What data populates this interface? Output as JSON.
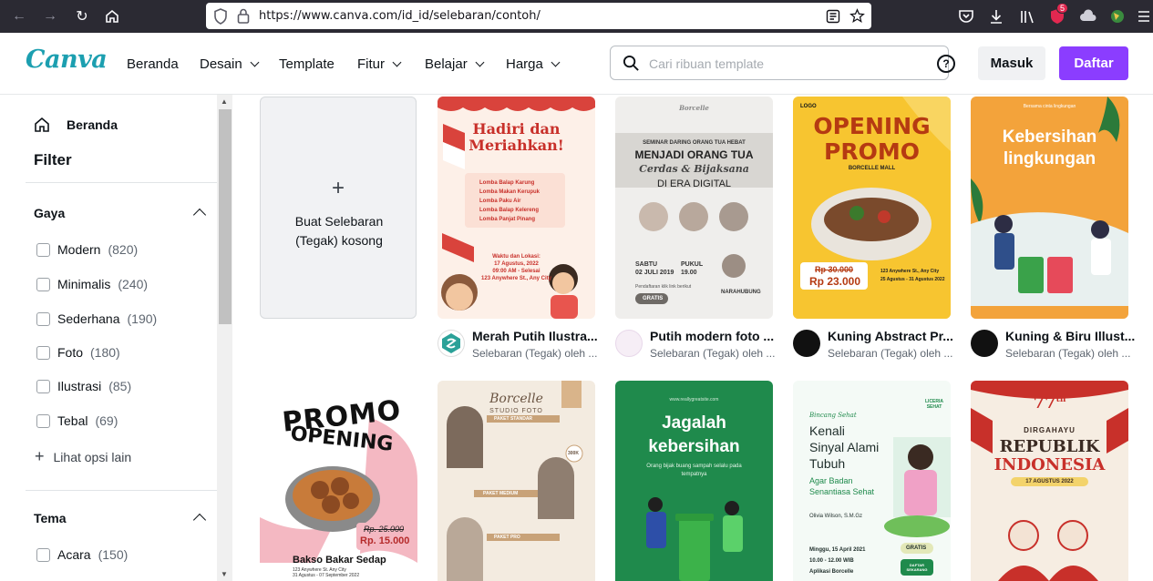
{
  "browser": {
    "url": "https://www.canva.com/id_id/selebaran/contoh/",
    "badge_count": "5"
  },
  "header": {
    "logo": "Canva",
    "nav": [
      {
        "label": "Beranda"
      },
      {
        "label": "Desain"
      },
      {
        "label": "Template"
      },
      {
        "label": "Fitur"
      },
      {
        "label": "Belajar"
      },
      {
        "label": "Harga"
      }
    ],
    "search_placeholder": "Cari ribuan template",
    "help": "?",
    "login_label": "Masuk",
    "signup_label": "Daftar",
    "accent_color": "#8b3dff"
  },
  "sidebar": {
    "home_label": "Beranda",
    "filter_title": "Filter",
    "gaya": {
      "title": "Gaya",
      "options": [
        {
          "label": "Modern",
          "count": "(820)"
        },
        {
          "label": "Minimalis",
          "count": "(240)"
        },
        {
          "label": "Sederhana",
          "count": "(190)"
        },
        {
          "label": "Foto",
          "count": "(180)"
        },
        {
          "label": "Ilustrasi",
          "count": "(85)"
        },
        {
          "label": "Tebal",
          "count": "(69)"
        }
      ],
      "more": "Lihat opsi lain"
    },
    "tema": {
      "title": "Tema",
      "options": [
        {
          "label": "Acara",
          "count": "(150)"
        }
      ]
    }
  },
  "grid": {
    "blank": {
      "plus": "+",
      "label_line1": "Buat Selebaran",
      "label_line2": "(Tegak) kosong"
    },
    "cards": [
      {
        "title": "Merah Putih Ilustra...",
        "subtitle": "Selebaran (Tegak) oleh ...",
        "preview": {
          "h1": "Hadiri dan",
          "h2": "Meriahkan!",
          "items": [
            "Lomba Balap Karung",
            "Lomba Makan Kerupuk",
            "Lomba Paku Air",
            "Lomba Balap Kelereng",
            "Lomba Panjat Pinang"
          ],
          "foot": "Waktu dan Lokasi:",
          "date": "17 Agustus, 2022",
          "time": "09:00 AM - Selesai",
          "addr": "123 Anywhere St., Any City"
        }
      },
      {
        "title": "Putih modern foto ...",
        "subtitle": "Selebaran (Tegak) oleh ...",
        "preview": {
          "brand": "Borcelle",
          "top": "SEMINAR DARING ORANG TUA HEBAT",
          "h1": "MENJADI ORANG TUA",
          "h2": "Cerdas & Bijaksana",
          "h3": "DI ERA DIGITAL",
          "day": "SABTU",
          "date": "02 JULI 2019",
          "pukul": "PUKUL",
          "time": "19.00",
          "reg": "Pendaftaran klik link berikut",
          "free": "GRATIS",
          "contact": "NARAHUBUNG"
        }
      },
      {
        "title": "Kuning Abstract Pr...",
        "subtitle": "Selebaran (Tegak) oleh ...",
        "preview": {
          "logo": "LOGO",
          "h1": "OPENING",
          "h2": "PROMO",
          "mall": "BORCELLE MALL",
          "old": "Rp 30.000",
          "new": "Rp 23.000",
          "addr": "123 Anywhere St., Any City",
          "date": "25 Agustus - 31 Agustus 2022"
        }
      },
      {
        "title": "Kuning & Biru Illust...",
        "subtitle": "Selebaran (Tegak) oleh ...",
        "preview": {
          "top": "Bersama cinta lingkungan",
          "h1": "Kebersihan",
          "h2": "lingkungan"
        }
      },
      {
        "preview": {
          "h1": "PROMO",
          "h2": "OPENING",
          "old": "Rp. 25.000",
          "new": "Rp. 15.000",
          "name": "Bakso Bakar Sedap",
          "addr": "123 Anywhere St. Any City",
          "date": "31 Agustus - 07 September 2022"
        }
      },
      {
        "preview": {
          "brand": "Borcelle",
          "sub": "STUDIO FOTO",
          "p1": "PAKET STANDAR",
          "p2": "PAKET MEDIUM",
          "p3": "PAKET PRO",
          "price": "300K"
        }
      },
      {
        "preview": {
          "site": "www.reallygreatsite.com",
          "h1": "Jagalah",
          "h2": "kebersihan",
          "sub": "Orang bijak buang sampah selalu pada tempatnya"
        }
      },
      {
        "preview": {
          "tag": "Bincang Sehat",
          "brand": "LICERIA SEHAT",
          "h1": "Kenali",
          "h2": "Sinyal Alami",
          "h3": "Tubuh",
          "h4": "Agar Badan",
          "h5": "Senantiasa Sehat",
          "speaker": "Olivia Wilson, S.M.Gz",
          "date": "Minggu, 15 April 2021",
          "time": "10.00 - 12.00 WIB",
          "app": "Aplikasi Borcelle",
          "free": "GRATIS",
          "reg": "DAFTAR SEKARANG"
        }
      },
      {
        "preview": {
          "num": "77",
          "sup": "th",
          "h1": "DIRGAHAYU",
          "h2": "REPUBLIK",
          "h3": "INDONESIA",
          "date": "17 AGUSTUS 2022"
        }
      }
    ]
  }
}
